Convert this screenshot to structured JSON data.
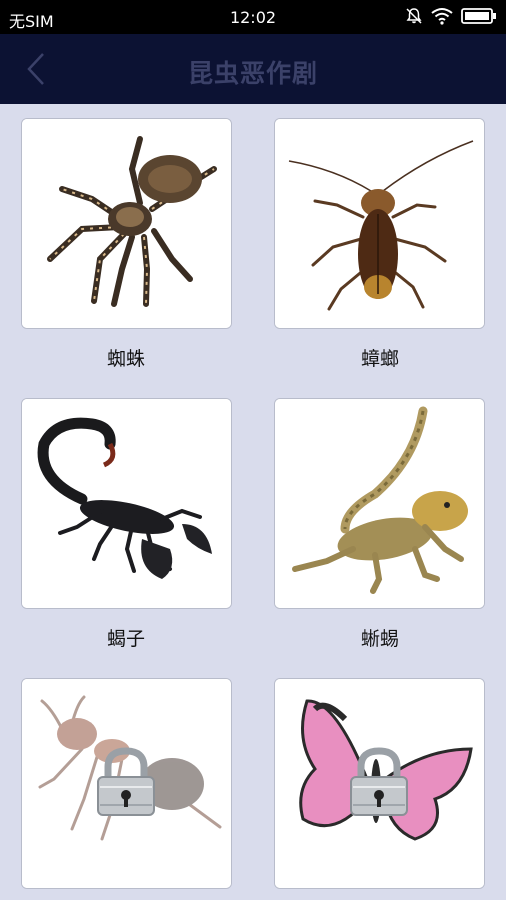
{
  "status_bar": {
    "carrier": "无SIM",
    "time": "12:02",
    "icons": [
      "bell-muted-icon",
      "wifi-icon",
      "battery-icon"
    ]
  },
  "header": {
    "back_icon": "chevron-left-icon",
    "title": "昆虫恶作剧"
  },
  "items": [
    {
      "label": "蜘蛛",
      "image": "tarantula-spider",
      "locked": false
    },
    {
      "label": "蟑螂",
      "image": "cockroach",
      "locked": false
    },
    {
      "label": "蝎子",
      "image": "scorpion",
      "locked": false
    },
    {
      "label": "蜥蜴",
      "image": "lizard",
      "locked": false
    },
    {
      "label": "",
      "image": "ant",
      "locked": true
    },
    {
      "label": "",
      "image": "butterfly",
      "locked": true
    }
  ],
  "colors": {
    "background": "#d9dcec",
    "header": "#0c1233",
    "title": "#3b4169"
  }
}
